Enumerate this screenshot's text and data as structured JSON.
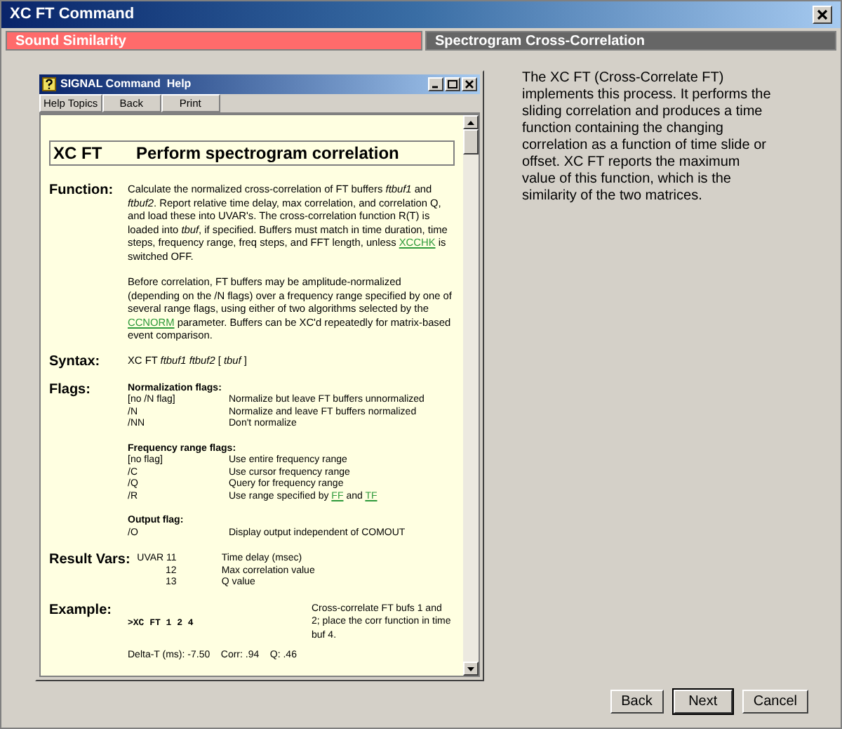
{
  "window": {
    "title": "XC FT Command"
  },
  "tabs": [
    {
      "label": "Sound Similarity",
      "selected": true
    },
    {
      "label": "Spectrogram Cross-Correlation",
      "selected": false
    }
  ],
  "help_window": {
    "title": "SIGNAL Command  Help",
    "toolbar": [
      "Help Topics",
      "Back",
      "Print"
    ],
    "heading": {
      "command": "XC FT",
      "title": "Perform spectrogram correlation"
    },
    "sections": [
      {
        "kind": "paragraphs",
        "label": "Function:",
        "paragraphs": [
          [
            {
              "kind": "text",
              "text": "Calculate the normalized cross-correlation of FT buffers *ftbuf1* and *ftbuf2*.  Report relative time delay, max correlation, and correlation Q, and load these into UVAR's.  The cross-correlation function R(T) is loaded into *tbuf*, if specified.  Buffers must match in time duration, time steps, frequency range, freq steps, and FFT length, unless"
            },
            {
              "kind": "link",
              "text": "XCCHK"
            },
            {
              "kind": "text",
              "text": "is switched OFF."
            }
          ],
          [
            {
              "kind": "text",
              "text": "Before correlation, FT buffers may be amplitude-normalized (depending on the /N flags) over a frequency range specified by one of several range flags, using either of two algorithms selected by the"
            },
            {
              "kind": "link",
              "text": "CCNORM"
            },
            {
              "kind": "text",
              "text": "parameter.  Buffers can be XC'd repeatedly for matrix-based event comparison."
            }
          ]
        ]
      },
      {
        "kind": "paragraphs",
        "label": "Syntax:",
        "paragraphs": [
          [
            {
              "kind": "text",
              "text": "XC  FT  *ftbuf1  ftbuf2*  [ *tbuf* ]"
            }
          ]
        ]
      },
      {
        "kind": "flags",
        "label": "Flags:",
        "groups": [
          {
            "title": "Normalization flags:",
            "rows": [
              {
                "flag": "[no /N flag]",
                "desc": [
                  {
                    "kind": "text",
                    "text": "Normalize but leave FT buffers unnormalized"
                  }
                ]
              },
              {
                "flag": "/N",
                "desc": [
                  {
                    "kind": "text",
                    "text": "Normalize and leave FT buffers normalized"
                  }
                ]
              },
              {
                "flag": "/NN",
                "desc": [
                  {
                    "kind": "text",
                    "text": "Don't normalize"
                  }
                ]
              }
            ]
          },
          {
            "title": "Frequency range flags:",
            "rows": [
              {
                "flag": "[no flag]",
                "desc": [
                  {
                    "kind": "text",
                    "text": "Use entire frequency range"
                  }
                ]
              },
              {
                "flag": "/C",
                "desc": [
                  {
                    "kind": "text",
                    "text": "Use cursor frequency range"
                  }
                ]
              },
              {
                "flag": "/Q",
                "desc": [
                  {
                    "kind": "text",
                    "text": "Query for frequency range"
                  }
                ]
              },
              {
                "flag": "/R",
                "desc": [
                  {
                    "kind": "text",
                    "text": "Use range specified by"
                  },
                  {
                    "kind": "link",
                    "text": "FF"
                  },
                  {
                    "kind": "text",
                    "text": "and"
                  },
                  {
                    "kind": "link",
                    "text": "TF"
                  }
                ]
              }
            ]
          },
          {
            "title": "Output flag:",
            "rows": [
              {
                "flag": "/O",
                "desc": [
                  {
                    "kind": "text",
                    "text": "Display output independent of COMOUT"
                  }
                ]
              }
            ]
          }
        ]
      },
      {
        "kind": "vars",
        "label": "Result Vars:",
        "rows": [
          {
            "var": "UVAR 11",
            "desc": "Time delay (msec)"
          },
          {
            "var": "12",
            "desc": "Max correlation value"
          },
          {
            "var": "13",
            "desc": "Q value"
          }
        ]
      },
      {
        "kind": "example",
        "label": "Example:",
        "command": ">XC FT 1 2 4",
        "desc": "Cross-correlate FT bufs 1 and 2; place the corr function in time buf 4.",
        "output": "Delta-T (ms): -7.50    Corr: .94    Q: .46"
      }
    ]
  },
  "description": "The XC FT (Cross-Correlate FT) implements this process.  It performs the sliding correlation and produces a time function containing the changing correlation as a function of time slide or offset.  XC FT reports the maximum value of this function, which is the similarity of the two matrices.",
  "buttons": [
    {
      "label": "Back",
      "default": false
    },
    {
      "label": "Next",
      "default": true
    },
    {
      "label": "Cancel",
      "default": false
    }
  ]
}
